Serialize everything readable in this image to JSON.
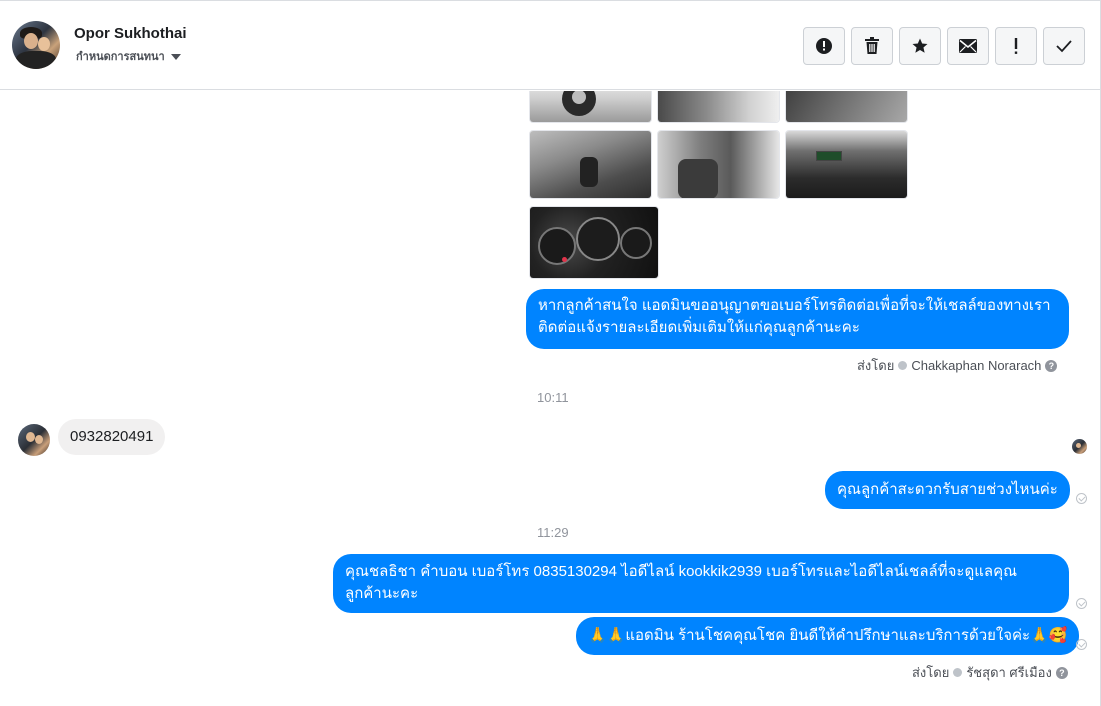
{
  "header": {
    "contact_name": "Opor Sukhothai",
    "label_text": "กำหนดการสนทนา",
    "toolbar": [
      {
        "name": "report-button",
        "icon": "alert-circle-icon"
      },
      {
        "name": "delete-button",
        "icon": "trash-icon"
      },
      {
        "name": "star-button",
        "icon": "star-icon"
      },
      {
        "name": "mark-unread-button",
        "icon": "envelope-icon"
      },
      {
        "name": "important-button",
        "icon": "exclamation-icon"
      },
      {
        "name": "mark-done-button",
        "icon": "checkmark-icon"
      }
    ]
  },
  "thread": {
    "photos": [
      "car-photo-1",
      "car-photo-2",
      "car-photo-3",
      "car-photo-4",
      "car-photo-5",
      "car-photo-6",
      "car-photo-7"
    ],
    "messages": {
      "m1_line1": "หากลูกค้าสนใจ แอดมินขออนุญาตขอเบอร์โทรติดต่อเพื่อที่จะให้เชลล์ของทางเรา",
      "m1_line2": "ติดต่อแจ้งรายละเอียดเพิ่มเติมให้แก่คุณลูกค้านะคะ",
      "sent_by_1_prefix": "ส่งโดย",
      "sent_by_1_name": "Chakkaphan Norarach",
      "time_1": "10:11",
      "incoming_phone": "0932820491",
      "m2": "คุณลูกค้าสะดวกรับสายช่วงไหนค่ะ",
      "time_2": "11:29",
      "m3_line1": "คุณชลธิชา คำบอน เบอร์โทร 0835130294  ไอดีไลน์ kookkik2939  เบอร์โทรและไอดีไลน์เชลล์ที่จะดูแลคุณ",
      "m3_line2": "ลูกค้านะคะ",
      "m4": "🙏🙏แอดมิน ร้านโชคคุณโชค ยินดีให้คำปรึกษาและบริการด้วยใจค่ะ🙏🥰",
      "sent_by_2_prefix": "ส่งโดย",
      "sent_by_2_name": "รัชสุดา ศรีเมือง"
    }
  },
  "colors": {
    "outgoing_bubble": "#0084ff",
    "incoming_bubble": "#f1f0f0",
    "muted_text": "#90949c"
  }
}
